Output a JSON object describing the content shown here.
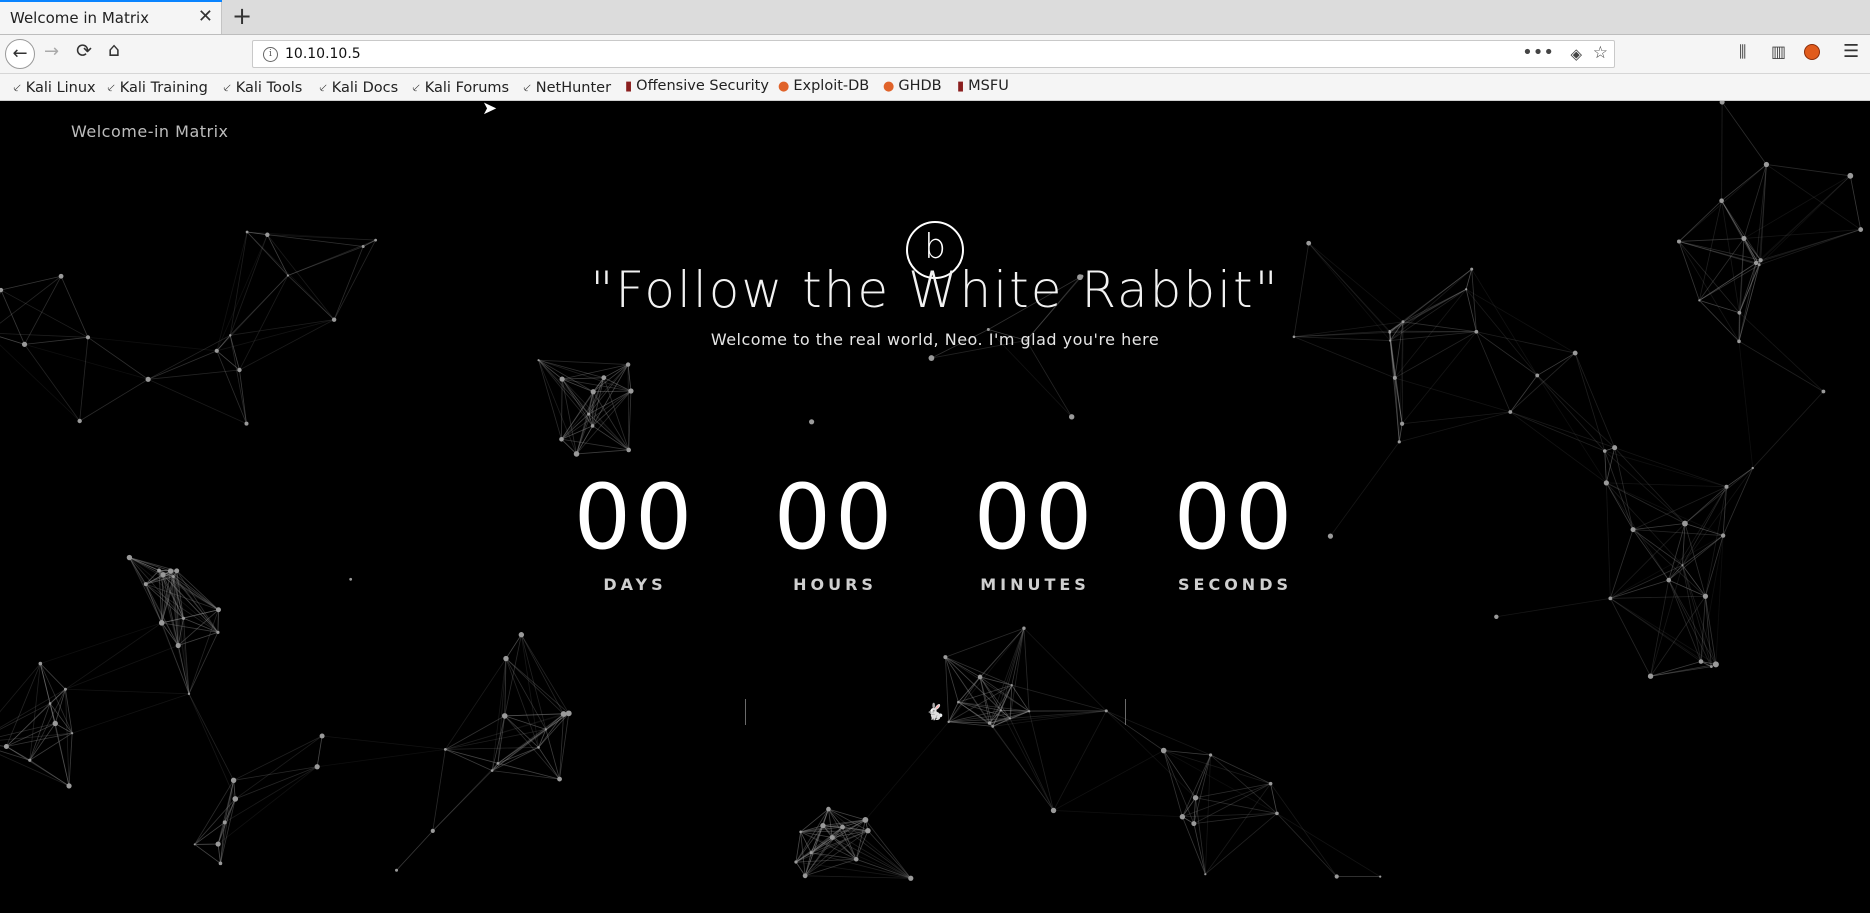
{
  "browser": {
    "tab_title": "Welcome in Matrix",
    "tab_close": "✕",
    "new_tab": "+",
    "url": "10.10.10.5",
    "bookmarks": [
      {
        "label": "Kali Linux",
        "icon": "kali-dragon-icon"
      },
      {
        "label": "Kali Training",
        "icon": "kali-dragon-icon"
      },
      {
        "label": "Kali Tools",
        "icon": "kali-dragon-icon"
      },
      {
        "label": "Kali Docs",
        "icon": "kali-dragon-icon"
      },
      {
        "label": "Kali Forums",
        "icon": "kali-dragon-icon"
      },
      {
        "label": "NetHunter",
        "icon": "kali-dragon-icon"
      },
      {
        "label": "Offensive Security",
        "icon": "offsec-icon"
      },
      {
        "label": "Exploit-DB",
        "icon": "exploit-db-icon"
      },
      {
        "label": "GHDB",
        "icon": "exploit-db-icon"
      },
      {
        "label": "MSFU",
        "icon": "offsec-icon"
      }
    ]
  },
  "page": {
    "brand": "Welcome-in Matrix",
    "logo_letter": "b",
    "headline": "\"Follow the White Rabbit\"",
    "subline": "Welcome to the real world, Neo. I'm glad you're here",
    "countdown": [
      {
        "value": "00",
        "label": "DAYS"
      },
      {
        "value": "00",
        "label": "HOURS"
      },
      {
        "value": "00",
        "label": "MINUTES"
      },
      {
        "value": "00",
        "label": "SECONDS"
      }
    ],
    "rabbit_icon": "rabbit-icon"
  },
  "colors": {
    "background": "#000000",
    "text": "#ffffff",
    "accent_tab": "#0a84ff"
  }
}
